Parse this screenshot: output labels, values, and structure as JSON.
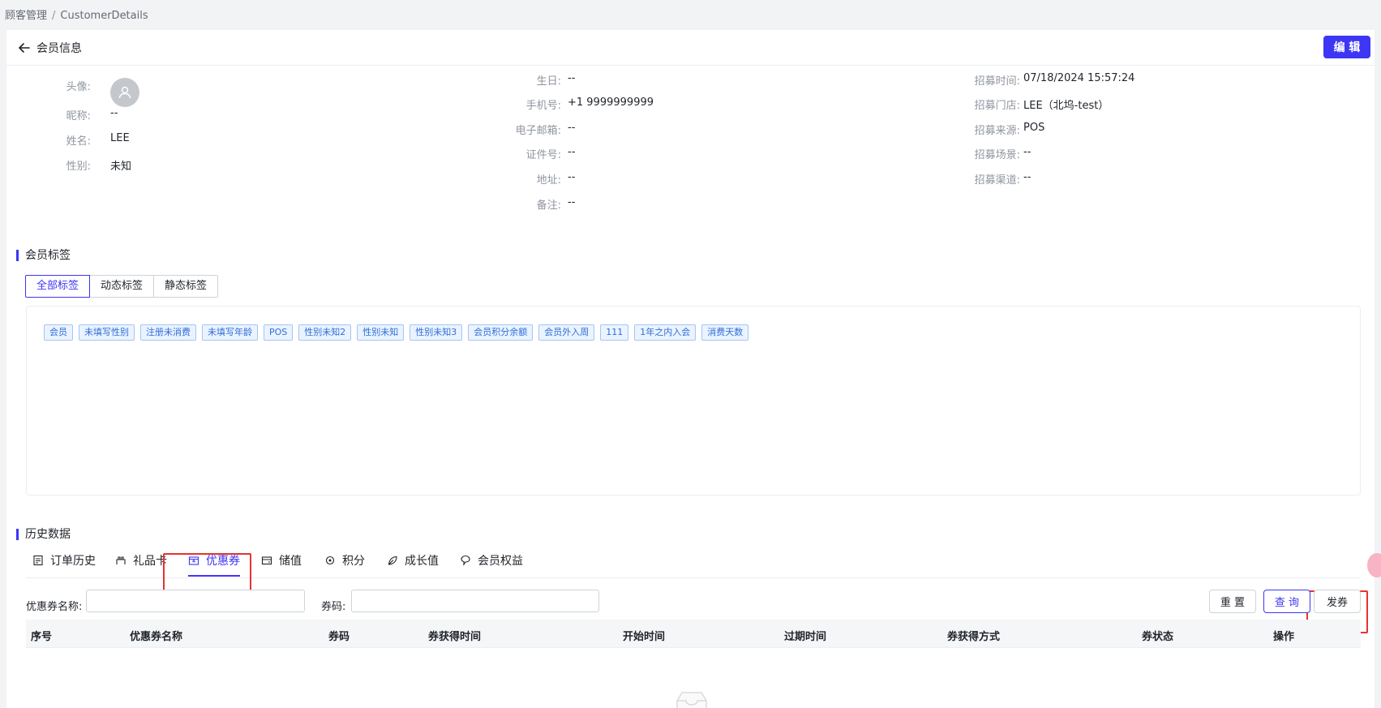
{
  "breadcrumb": {
    "parent": "顾客管理",
    "separator": "/",
    "current": "CustomerDetails"
  },
  "header": {
    "title": "会员信息",
    "edit_label": "编 辑"
  },
  "info": {
    "col1": [
      {
        "label": "头像:",
        "value": ""
      },
      {
        "label": "昵称:",
        "value": "--"
      },
      {
        "label": "姓名:",
        "value": "LEE"
      },
      {
        "label": "性别:",
        "value": "未知"
      }
    ],
    "col2": [
      {
        "label": "生日:",
        "value": "--"
      },
      {
        "label": "手机号:",
        "value": "+1 9999999999"
      },
      {
        "label": "电子邮箱:",
        "value": "--"
      },
      {
        "label": "证件号:",
        "value": "--"
      },
      {
        "label": "地址:",
        "value": "--"
      },
      {
        "label": "备注:",
        "value": "--"
      }
    ],
    "col3": [
      {
        "label": "招募时间:",
        "value": "07/18/2024 15:57:24"
      },
      {
        "label": "招募门店:",
        "value": "LEE（北坞-test）"
      },
      {
        "label": "招募来源:",
        "value": "POS"
      },
      {
        "label": "招募场景:",
        "value": "--"
      },
      {
        "label": "招募渠道:",
        "value": "--"
      }
    ]
  },
  "tags_section": {
    "title": "会员标签",
    "tabs": [
      "全部标签",
      "动态标签",
      "静态标签"
    ],
    "active_tab": "全部标签",
    "tags": [
      "会员",
      "未填写性别",
      "注册未消费",
      "未填写年龄",
      "POS",
      "性别未知2",
      "性别未知",
      "性别未知3",
      "会员积分余额",
      "会员外入周",
      "111",
      "1年之内入会",
      "消费天数"
    ]
  },
  "history_section": {
    "title": "历史数据",
    "tabs": [
      {
        "label": "订单历史",
        "icon": "order-icon"
      },
      {
        "label": "礼品卡",
        "icon": "gift-card-icon"
      },
      {
        "label": "优惠券",
        "icon": "coupon-icon"
      },
      {
        "label": "储值",
        "icon": "wallet-icon"
      },
      {
        "label": "积分",
        "icon": "points-icon"
      },
      {
        "label": "成长值",
        "icon": "leaf-icon"
      },
      {
        "label": "会员权益",
        "icon": "benefit-icon"
      }
    ],
    "active_tab": "优惠券",
    "filters": {
      "coupon_name_label": "优惠券名称:",
      "coupon_name_value": "",
      "coupon_code_label": "券码:",
      "coupon_code_value": ""
    },
    "buttons": {
      "reset": "重 置",
      "search": "查 询",
      "issue": "发券"
    },
    "table_columns": [
      "序号",
      "优惠券名称",
      "券码",
      "券获得时间",
      "开始时间",
      "过期时间",
      "券获得方式",
      "券状态",
      "操作"
    ],
    "rows": []
  },
  "colors": {
    "accent": "#3d36f4",
    "highlight": "#e8322f",
    "tag_text": "#2e6dd8"
  }
}
